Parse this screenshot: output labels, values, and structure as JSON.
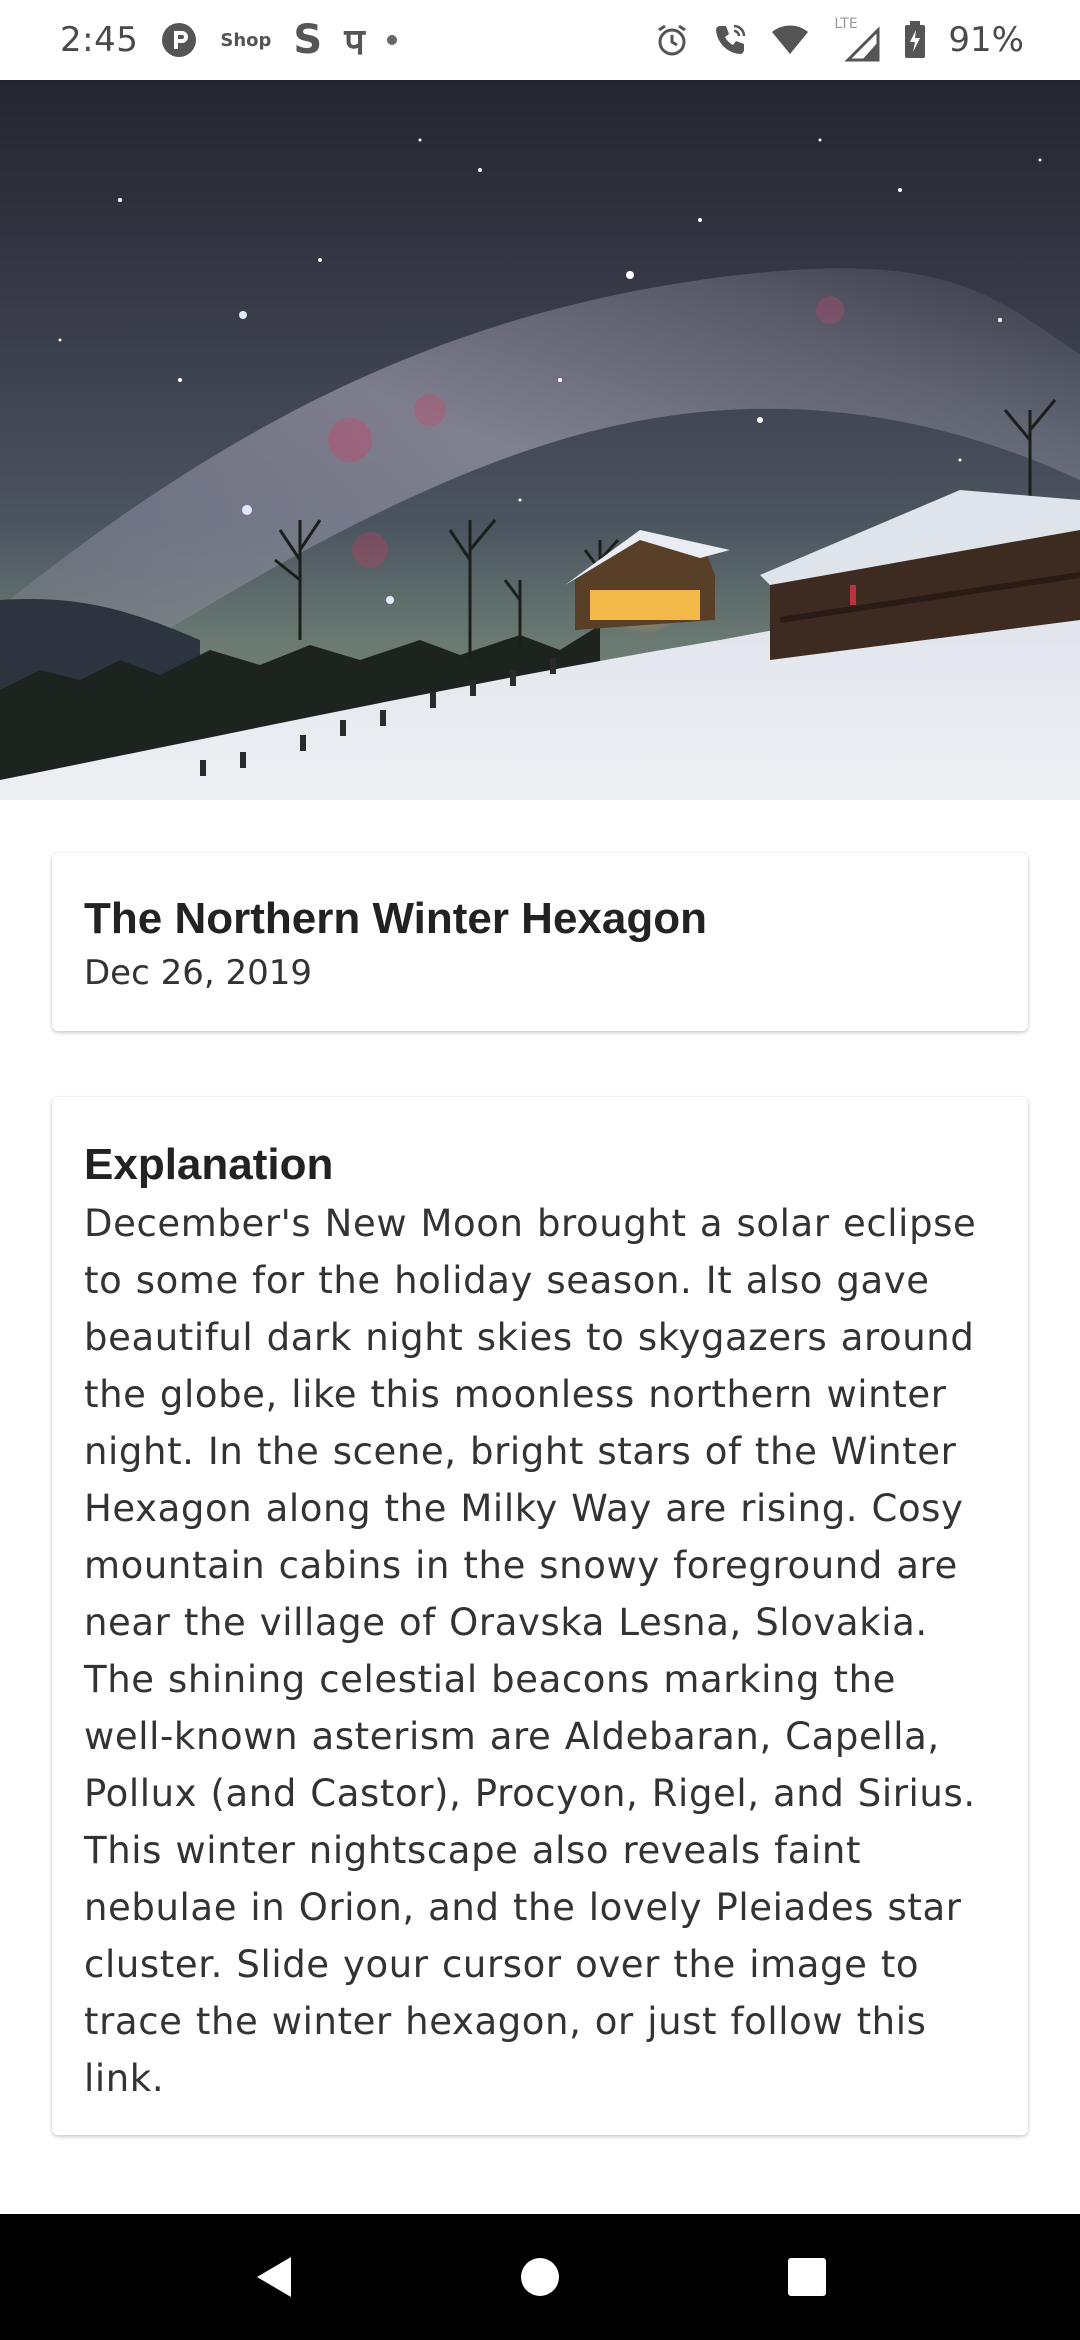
{
  "status_bar": {
    "time": "2:45",
    "left_icons": [
      "p-circle-icon",
      "shop-icon",
      "s-icon",
      "hindi-letter-icon",
      "dot-icon"
    ],
    "shop_label": "Shop",
    "s_label": "S",
    "hindi_label": "प",
    "right_icons": [
      "alarm-icon",
      "wifi-call-icon",
      "wifi-icon",
      "lte-signal-icon",
      "battery-charging-icon"
    ],
    "lte_label": "LTE",
    "battery_percent": "91%"
  },
  "hero_image": {
    "subject": "Milky Way over snowy mountain cabins at night"
  },
  "title_card": {
    "title": "The Northern Winter Hexagon",
    "date": "Dec 26, 2019"
  },
  "explanation_card": {
    "heading": "Explanation",
    "body": "December's New Moon brought a solar eclipse to some for the holiday season. It also gave beautiful dark night skies to skygazers around the globe, like this moonless northern winter night. In the scene, bright stars of the Winter Hexagon along the Milky Way are rising. Cosy mountain cabins in the snowy foreground are near the village of Oravska Lesna, Slovakia. The shining celestial beacons marking the well-known asterism are Aldebaran, Capella, Pollux (and Castor), Procyon, Rigel, and Sirius. This winter nightscape also reveals faint nebulae in Orion, and the lovely Pleiades star cluster. Slide your cursor over the image to trace the winter hexagon, or just follow this link."
  },
  "nav_bar": {
    "buttons": [
      "back-icon",
      "home-icon",
      "recents-icon"
    ]
  },
  "colors": {
    "background": "#ffffff",
    "text_primary": "#222222",
    "text_body": "#333333",
    "nav_bar": "#000000"
  }
}
